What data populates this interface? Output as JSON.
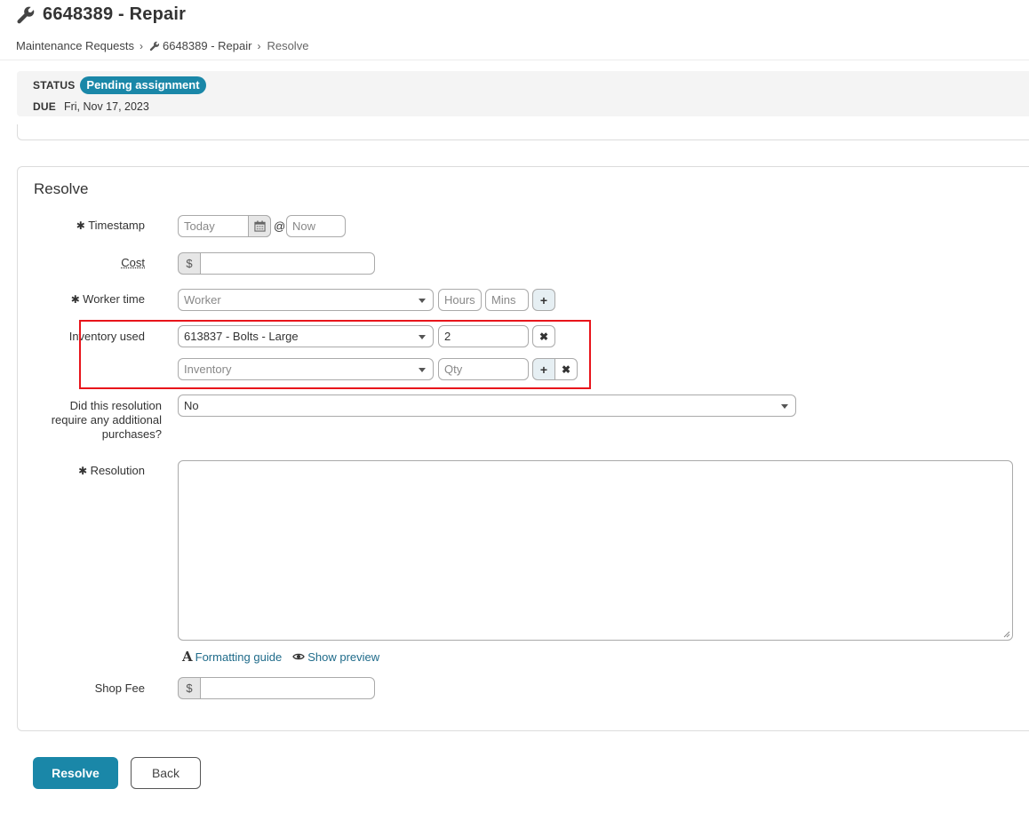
{
  "header": {
    "title": "6648389 - Repair"
  },
  "breadcrumb": {
    "items": [
      "Maintenance Requests",
      "6648389 - Repair",
      "Resolve"
    ]
  },
  "status": {
    "status_label": "STATUS",
    "status_value": "Pending assignment",
    "due_label": "DUE",
    "due_value": "Fri, Nov 17, 2023"
  },
  "form": {
    "title": "Resolve",
    "timestamp": {
      "label": "Timestamp",
      "date_placeholder": "Today",
      "at": "@",
      "time_placeholder": "Now"
    },
    "cost": {
      "label": "Cost",
      "prefix": "$",
      "value": ""
    },
    "worker_time": {
      "label": "Worker time",
      "worker_placeholder": "Worker",
      "hours_placeholder": "Hours",
      "mins_placeholder": "Mins"
    },
    "inventory": {
      "label": "Inventory used",
      "rows": [
        {
          "item": "613837 - Bolts - Large",
          "qty": "2"
        },
        {
          "item_placeholder": "Inventory",
          "qty_placeholder": "Qty"
        }
      ]
    },
    "additional_purchases": {
      "label": "Did this resolution require any additional purchases?",
      "value": "No"
    },
    "resolution": {
      "label": "Resolution",
      "value": ""
    },
    "formatting_guide": "Formatting guide",
    "show_preview": "Show preview",
    "shop_fee": {
      "label": "Shop Fee",
      "prefix": "$",
      "value": ""
    }
  },
  "actions": {
    "resolve": "Resolve",
    "back": "Back"
  },
  "colors": {
    "accent": "#1a87a8",
    "highlight": "#e8141b"
  }
}
